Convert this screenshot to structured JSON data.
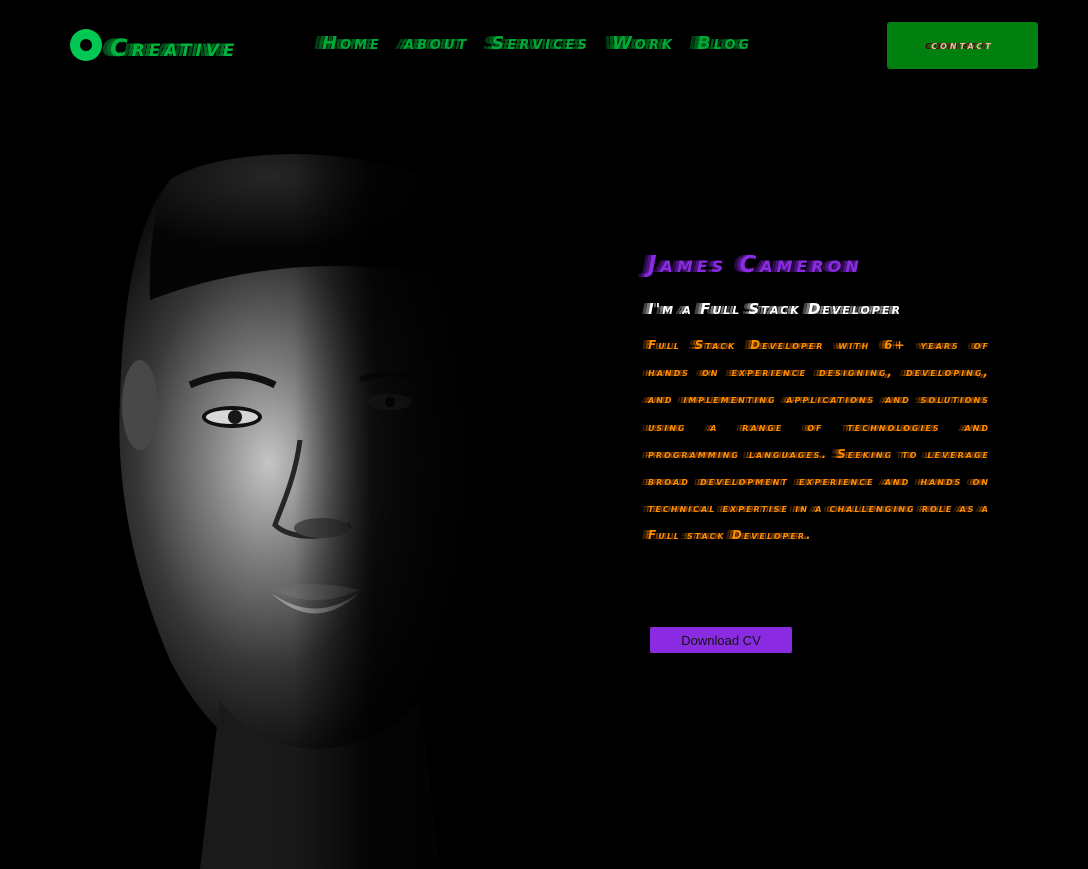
{
  "header": {
    "logo_text": "Creative",
    "nav": [
      {
        "label": "Home"
      },
      {
        "label": "about"
      },
      {
        "label": "Services"
      },
      {
        "label": "Work"
      },
      {
        "label": "Blog"
      }
    ],
    "contact_label": "contact"
  },
  "hero": {
    "name": "James Cameron",
    "role": "I'm a Full Stack Developer",
    "description": "Full Stack Developer with 6+ years of hands on experience designing, developing, and implementing applications and solutions using a range of technologies and programming languages. Seeking to leverage broad development experience and hands on technical expertise in a challenging role as a Full stack Developer.",
    "download_label": "Download CV"
  },
  "colors": {
    "background": "#000000",
    "brand_green": "#00b33c",
    "contact_bg": "#00800f",
    "accent_purple": "#8a2be2",
    "description_orange": "#ff8c00"
  },
  "icons": {
    "logo": "ring-logo-icon"
  }
}
